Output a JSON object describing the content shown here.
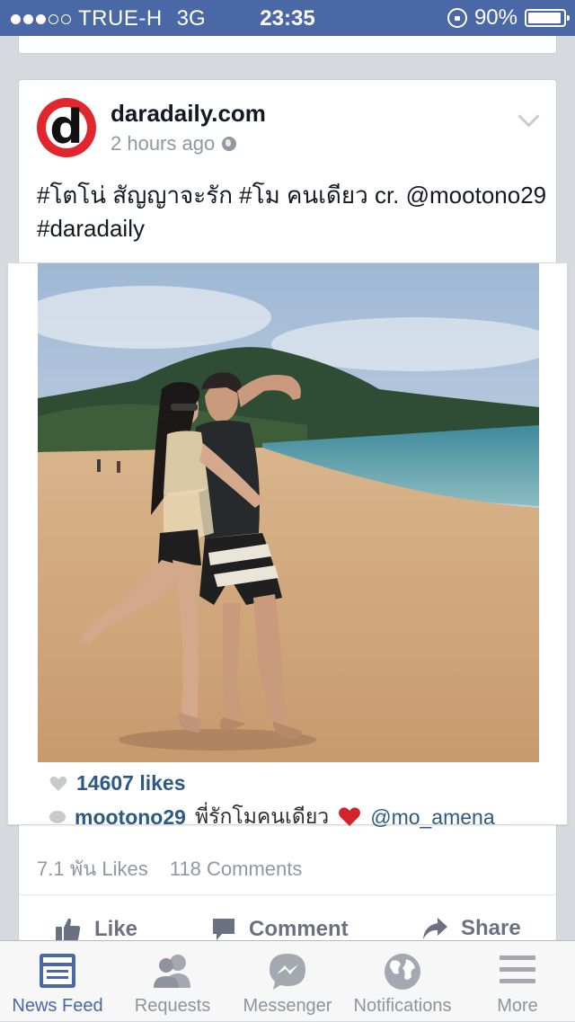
{
  "status_bar": {
    "carrier": "TRUE-H",
    "network": "3G",
    "time": "23:35",
    "battery": "90%",
    "signal_dots_filled": 3,
    "signal_dots_total": 5
  },
  "post": {
    "page_name": "daradaily.com",
    "avatar_letter": "d",
    "time_ago": "2 hours ago",
    "text_line1": "#โตโน่ สัญญาจะรัก #โม คนเดียว  cr. @mootono29",
    "text_line2": "#daradaily",
    "photo": {
      "likes": "14607 likes",
      "comment_user": "mootono29",
      "comment_text": "พี่รักโมคนเดียว",
      "comment_mention": "@mo_amena"
    },
    "likes_count": "7.1 พัน Likes",
    "comments_count": "118 Comments"
  },
  "actions": {
    "like": "Like",
    "comment": "Comment",
    "share": "Share"
  },
  "tabs": [
    {
      "label": "News Feed",
      "icon": "news-feed-icon",
      "active": true
    },
    {
      "label": "Requests",
      "icon": "friend-requests-icon",
      "active": false
    },
    {
      "label": "Messenger",
      "icon": "messenger-icon",
      "active": false
    },
    {
      "label": "Notifications",
      "icon": "globe-icon",
      "active": false
    },
    {
      "label": "More",
      "icon": "menu-icon",
      "active": false
    }
  ],
  "colors": {
    "facebook_blue": "#4a67a6",
    "muted_text": "#9197a3",
    "instagram_link": "#2d5a83",
    "logo_red": "#e1262d"
  }
}
